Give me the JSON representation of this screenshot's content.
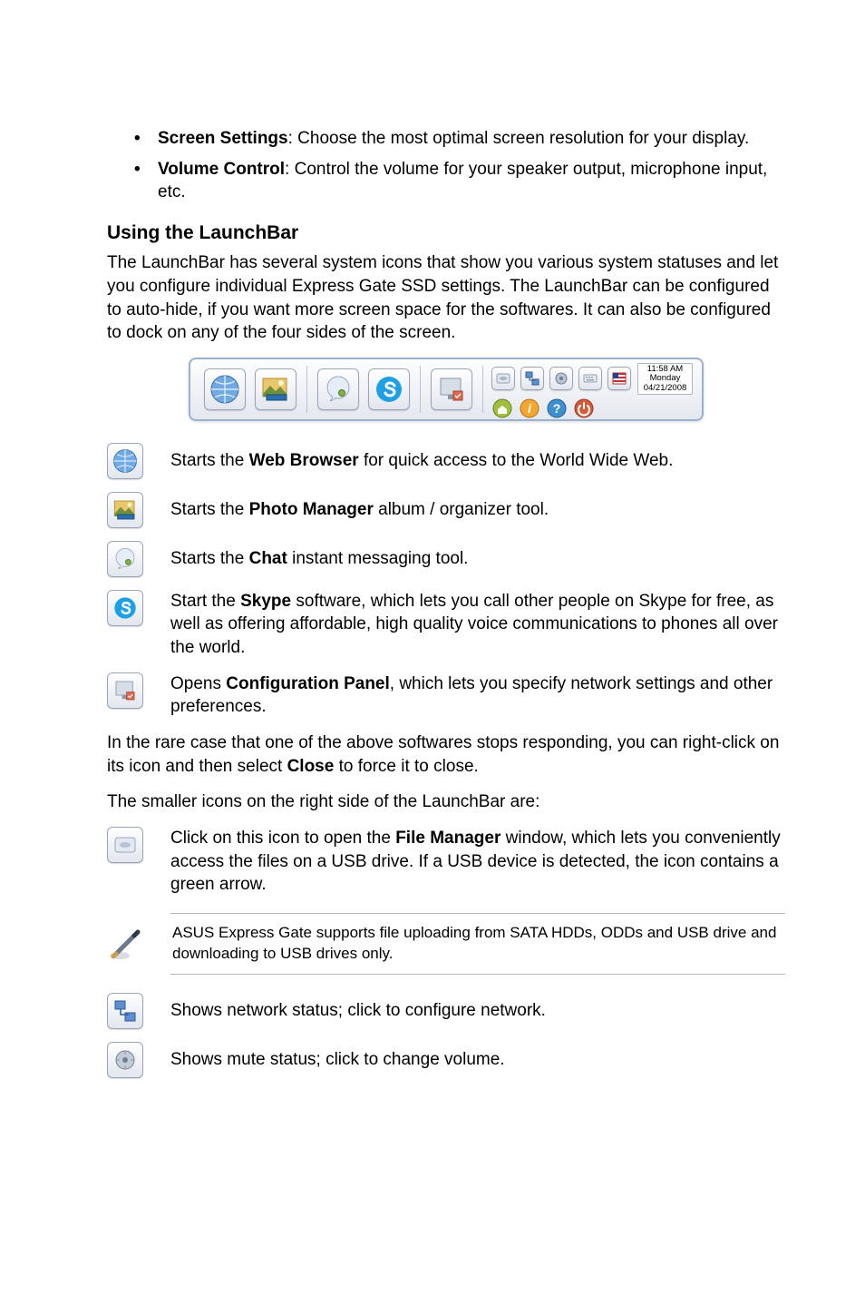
{
  "bullets": [
    {
      "term": "Screen Settings",
      "text": ": Choose the most optimal screen resolution for your display."
    },
    {
      "term": "Volume Control",
      "text": ": Control the volume for your speaker output, microphone input, etc."
    }
  ],
  "heading": "Using the LaunchBar",
  "intro": "The LaunchBar has several system icons that show you various system statuses and let you configure individual Express Gate SSD settings. The LaunchBar can be configured to auto-hide, if you want more screen space for the softwares. It can also be configured to dock on any of the four sides of the screen.",
  "clock": {
    "time": "11:58 AM",
    "day": "Monday",
    "date": "04/21/2008"
  },
  "rows": {
    "web": {
      "pre": "Starts the ",
      "term": "Web Browser",
      "post": " for quick access to the World Wide Web."
    },
    "photo": {
      "pre": "Starts the ",
      "term": "Photo Manager",
      "post": " album / organizer tool."
    },
    "chat": {
      "pre": "Starts the ",
      "term": "Chat",
      "post": " instant messaging tool."
    },
    "skype": {
      "pre": "Start the ",
      "term": "Skype",
      "post": " software, which lets you call other people on Skype for free, as well as offering affordable, high quality voice communications to phones all over the world."
    },
    "config": {
      "pre": "Opens ",
      "term": "Configuration Panel",
      "post": ", which lets you specify network settings and other preferences."
    }
  },
  "close_para": {
    "pre": "In the rare case that one of the above softwares stops responding, you can right-click on its icon and then select ",
    "term": "Close",
    "post": " to force it to close."
  },
  "smaller_para": "The smaller icons on the right side of the LaunchBar are:",
  "file_row": {
    "pre": "Click on this icon to open the ",
    "term": "File Manager",
    "post": " window, which lets you conveniently access the files on a USB drive. If a USB device is detected, the icon contains a green arrow."
  },
  "note": "ASUS Express Gate supports file uploading from SATA HDDs, ODDs and USB drive and downloading to USB drives only.",
  "network_row": "Shows network status; click to configure network.",
  "mute_row": "Shows mute status; click to change volume."
}
